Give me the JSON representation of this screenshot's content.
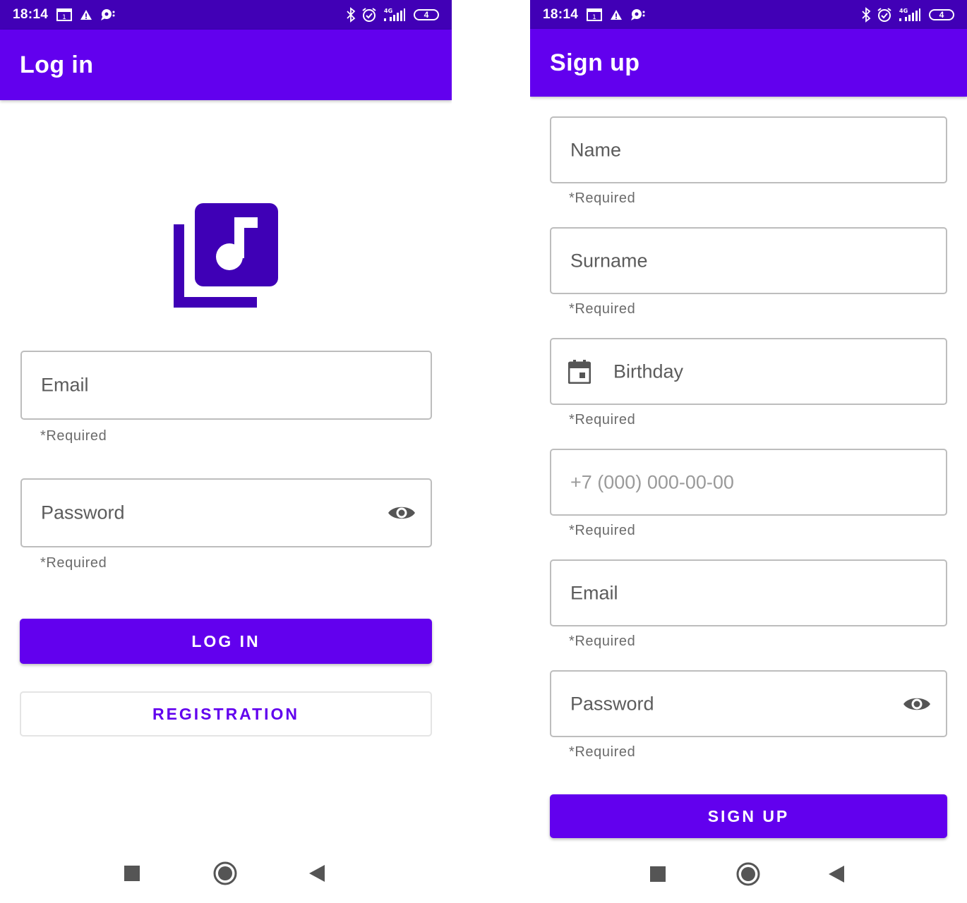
{
  "status_bar": {
    "time": "18:14",
    "battery_level": "4",
    "network": "4G",
    "icons_left": [
      "calendar-notification-icon",
      "alert-triangle-icon",
      "chat-notification-icon"
    ],
    "icons_right": [
      "bluetooth-icon",
      "alarm-icon",
      "signal-icon",
      "battery-icon"
    ]
  },
  "colors": {
    "status_bar": "#4100b6",
    "app_bar": "#6200ee",
    "logo": "#3f00b6",
    "primary": "#6200ee",
    "field_border": "#bdbdbd",
    "label": "#5c5c5c",
    "helper": "#6b6b6b"
  },
  "login": {
    "title": "Log in",
    "logo_icon": "music-library-icon",
    "email": {
      "label": "Email",
      "helper": "*Required"
    },
    "password": {
      "label": "Password",
      "helper": "*Required",
      "icon": "eye-icon"
    },
    "login_button": "LOG IN",
    "registration_button": "REGISTRATION"
  },
  "signup": {
    "title": "Sign up",
    "name": {
      "label": "Name",
      "helper": "*Required"
    },
    "surname": {
      "label": "Surname",
      "helper": "*Required"
    },
    "birthday": {
      "label": "Birthday",
      "helper": "*Required",
      "icon": "calendar-icon"
    },
    "phone": {
      "placeholder": "+7 (000) 000-00-00",
      "helper": "*Required"
    },
    "email": {
      "label": "Email",
      "helper": "*Required"
    },
    "password": {
      "label": "Password",
      "helper": "*Required",
      "icon": "eye-icon"
    },
    "signup_button": "SIGN UP"
  },
  "navigation": [
    "recents-button",
    "home-button",
    "back-button"
  ]
}
